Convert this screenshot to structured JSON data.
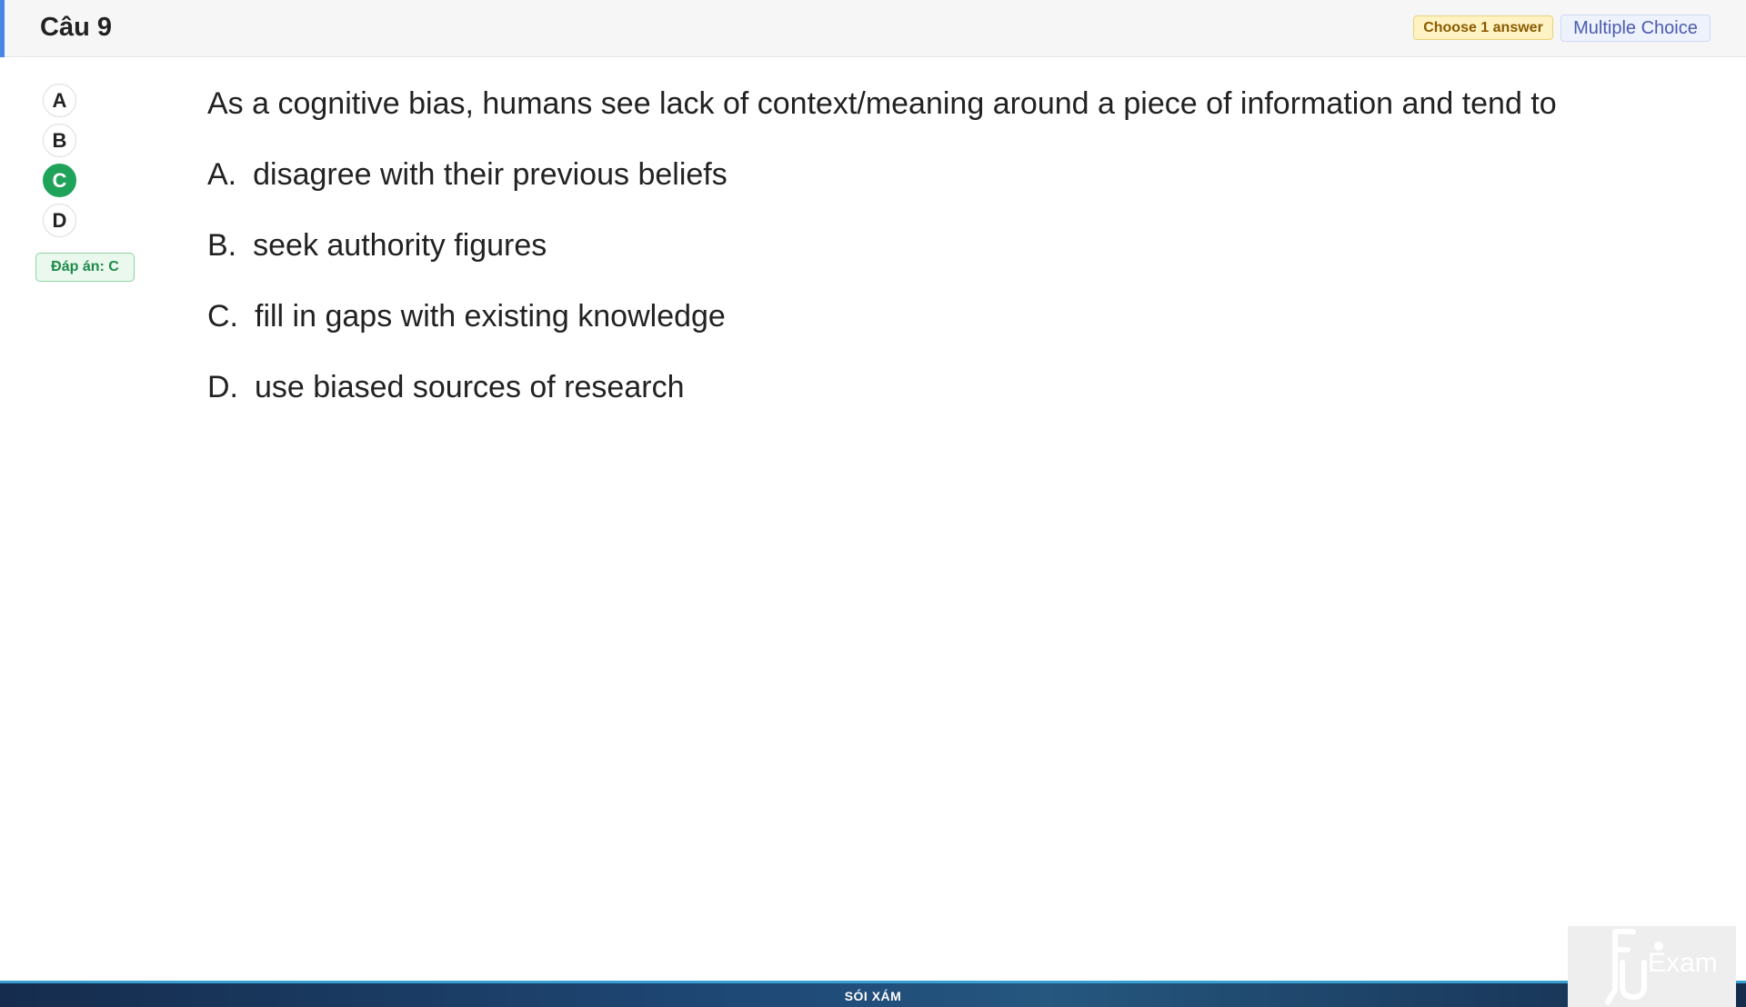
{
  "header": {
    "title": "Câu 9",
    "instruction_badge": "Choose 1 answer",
    "type_badge": "Multiple Choice"
  },
  "answer_selector": {
    "options": [
      "A",
      "B",
      "C",
      "D"
    ],
    "selected": "C",
    "answer_label": "Đáp án: C"
  },
  "question": {
    "text": "As a cognitive bias, humans see lack of context/meaning around a piece of information and tend to",
    "choices": [
      {
        "letter": "A.",
        "text": "disagree with their previous beliefs"
      },
      {
        "letter": "B.",
        "text": "seek authority figures"
      },
      {
        "letter": "C.",
        "text": "fill in gaps with existing knowledge"
      },
      {
        "letter": "D.",
        "text": "use biased sources of research"
      }
    ]
  },
  "footer": {
    "text": "SÓI XÁM"
  },
  "logo": {
    "text": "Exam",
    "icon": "fu-exam-logo-icon"
  },
  "colors": {
    "header_accent": "#4a86e8",
    "selected": "#1fa35a",
    "footer": "#1f4a78"
  }
}
